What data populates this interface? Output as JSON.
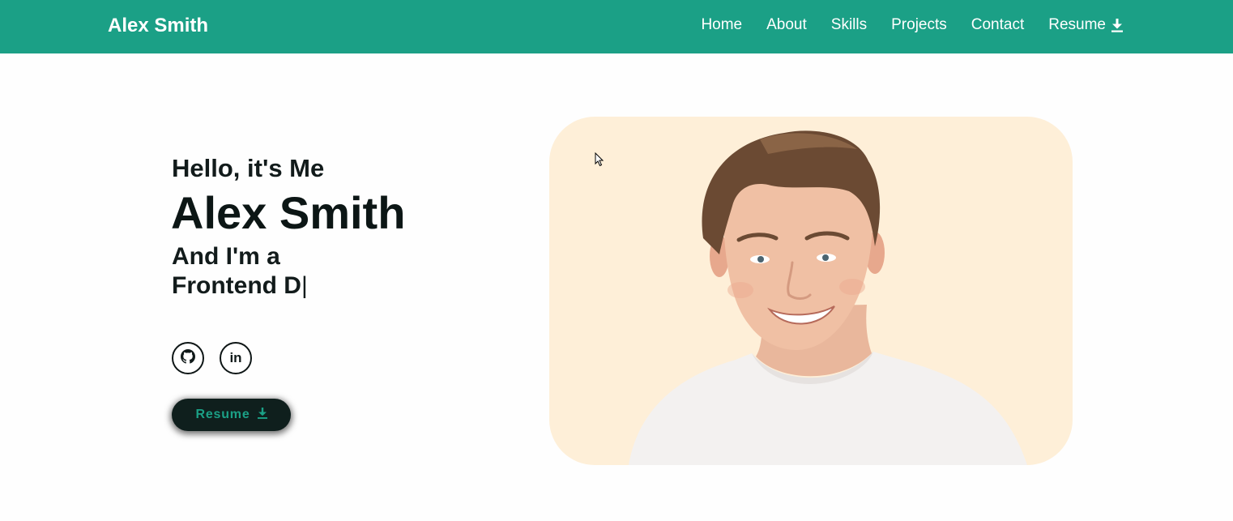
{
  "navbar": {
    "brand": "Alex Smith",
    "links": [
      {
        "label": "Home"
      },
      {
        "label": "About"
      },
      {
        "label": "Skills"
      },
      {
        "label": "Projects"
      },
      {
        "label": "Contact"
      },
      {
        "label": "Resume",
        "icon": "download-icon"
      }
    ],
    "background_color": "#1ba086"
  },
  "hero": {
    "greeting": "Hello, it's Me",
    "name": "Alex Smith",
    "role_prefix": "And I'm a",
    "role_typed": "Frontend D",
    "caret": "|",
    "social": [
      {
        "name": "github",
        "icon": "github-icon"
      },
      {
        "name": "linkedin",
        "icon": "linkedin-icon",
        "glyph": "in"
      }
    ],
    "resume_button": {
      "label": "Resume",
      "icon": "download-icon",
      "background_color": "#0f1f1d",
      "text_color": "#1ba086"
    },
    "photo": {
      "description_icon": "profile-photo",
      "background_color": "#feefd8"
    }
  }
}
